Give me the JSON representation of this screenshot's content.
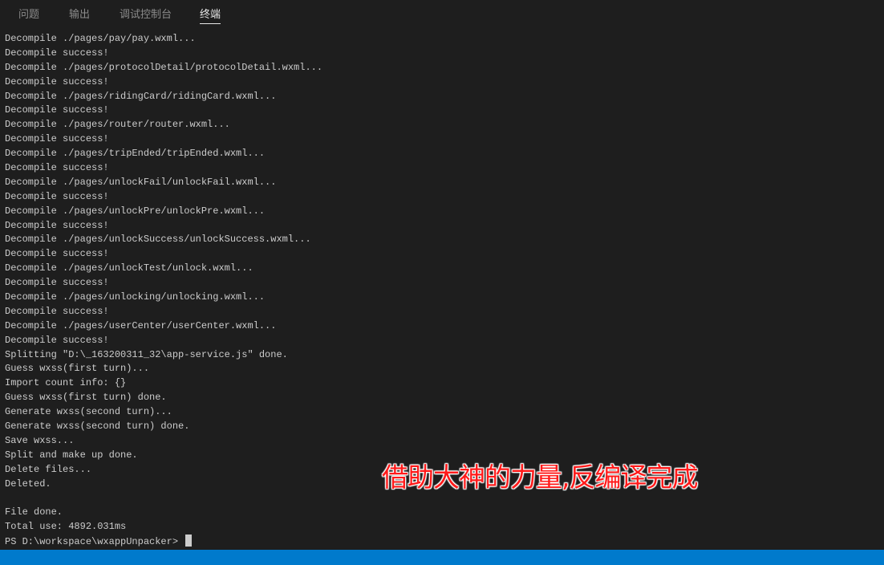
{
  "tabs": [
    "问题",
    "输出",
    "调试控制台",
    "终端"
  ],
  "active_tab": "终端",
  "terminal_lines": [
    "Decompile ./pages/pay/pay.wxml...",
    "Decompile success!",
    "Decompile ./pages/protocolDetail/protocolDetail.wxml...",
    "Decompile success!",
    "Decompile ./pages/ridingCard/ridingCard.wxml...",
    "Decompile success!",
    "Decompile ./pages/router/router.wxml...",
    "Decompile success!",
    "Decompile ./pages/tripEnded/tripEnded.wxml...",
    "Decompile success!",
    "Decompile ./pages/unlockFail/unlockFail.wxml...",
    "Decompile success!",
    "Decompile ./pages/unlockPre/unlockPre.wxml...",
    "Decompile success!",
    "Decompile ./pages/unlockSuccess/unlockSuccess.wxml...",
    "Decompile success!",
    "Decompile ./pages/unlockTest/unlock.wxml...",
    "Decompile success!",
    "Decompile ./pages/unlocking/unlocking.wxml...",
    "Decompile success!",
    "Decompile ./pages/userCenter/userCenter.wxml...",
    "Decompile success!",
    "Splitting \"D:\\_163200311_32\\app-service.js\" done.",
    "Guess wxss(first turn)...",
    "Import count info: {}",
    "Guess wxss(first turn) done.",
    "Generate wxss(second turn)...",
    "Generate wxss(second turn) done.",
    "Save wxss...",
    "Split and make up done.",
    "Delete files...",
    "Deleted.",
    "",
    "File done.",
    "Total use: 4892.031ms"
  ],
  "prompt": "PS D:\\workspace\\wxappUnpacker> ",
  "caption": "借助大神的力量,反编译完成",
  "colors": {
    "background": "#1e1e1e",
    "status_bar": "#007acc",
    "caption": "#ff1a1a"
  }
}
